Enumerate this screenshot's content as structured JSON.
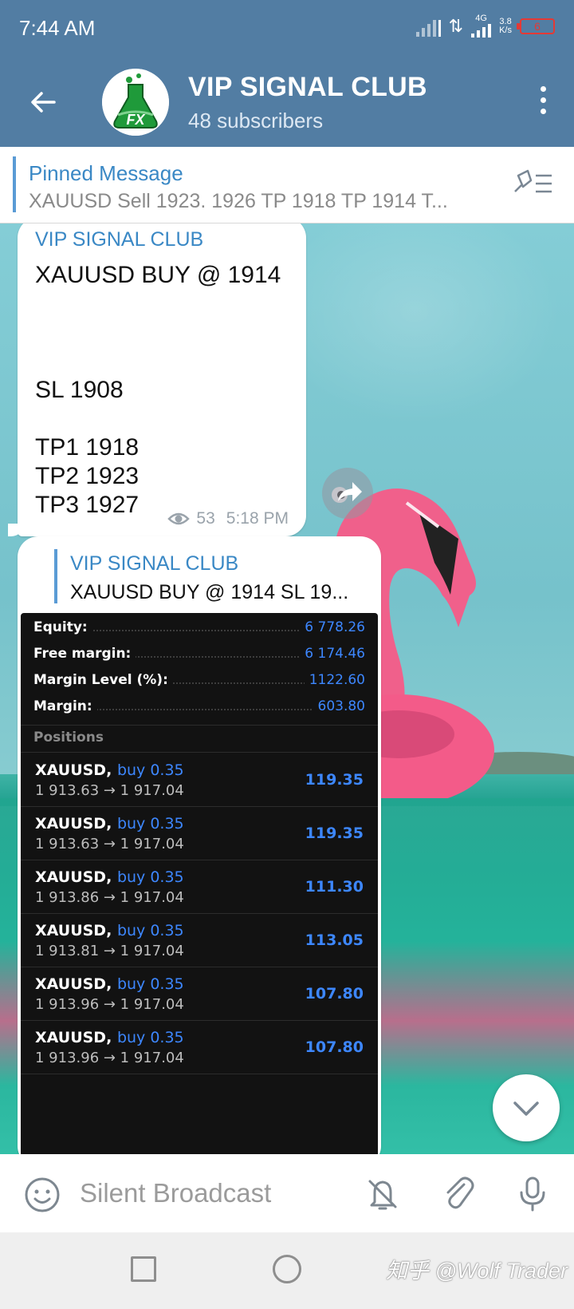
{
  "status_bar": {
    "time": "7:44 AM",
    "network_type": "4G",
    "speed_value": "3.8",
    "speed_unit": "K/s",
    "battery": "6",
    "battery_color": "#e53935"
  },
  "header": {
    "title": "VIP SIGNAL CLUB",
    "subtitle": "48 subscribers",
    "avatar_text": "FX",
    "color": "#527da3"
  },
  "pinned": {
    "label": "Pinned Message",
    "text": "XAUUSD Sell 1923.  1926 TP 1918 TP 1914 T..."
  },
  "messages": [
    {
      "sender": "VIP SIGNAL CLUB",
      "lines": [
        "XAUUSD BUY @ 1914",
        "SL 1908",
        "TP1 1918",
        "TP2 1923",
        "TP3 1927"
      ],
      "views": "53",
      "time": "5:18 PM"
    },
    {
      "sender": "VIP SIGNAL CLUB",
      "reply_text": "XAUUSD BUY @ 1914    SL 19...",
      "account": [
        {
          "label": "Equity:",
          "value": "6 778.26"
        },
        {
          "label": "Free margin:",
          "value": "6 174.46"
        },
        {
          "label": "Margin Level (%):",
          "value": "1122.60"
        },
        {
          "label": "Margin:",
          "value": "603.80"
        }
      ],
      "positions_header": "Positions",
      "positions": [
        {
          "symbol": "XAUUSD,",
          "side": "buy 0.35",
          "prices": "1 913.63 → 1 917.04",
          "profit": "119.35"
        },
        {
          "symbol": "XAUUSD,",
          "side": "buy 0.35",
          "prices": "1 913.63 → 1 917.04",
          "profit": "119.35"
        },
        {
          "symbol": "XAUUSD,",
          "side": "buy 0.35",
          "prices": "1 913.86 → 1 917.04",
          "profit": "111.30"
        },
        {
          "symbol": "XAUUSD,",
          "side": "buy 0.35",
          "prices": "1 913.81 → 1 917.04",
          "profit": "113.05"
        },
        {
          "symbol": "XAUUSD,",
          "side": "buy 0.35",
          "prices": "1 913.96 → 1 917.04",
          "profit": "107.80"
        },
        {
          "symbol": "XAUUSD,",
          "side": "buy 0.35",
          "prices": "1 913.96 → 1 917.04",
          "profit": "107.80"
        }
      ]
    }
  ],
  "composer": {
    "placeholder": "Silent Broadcast"
  },
  "icons": {
    "back": "arrow-left-icon",
    "menu": "more-vertical-icon",
    "pin": "pin-list-icon",
    "views": "eye-icon",
    "share": "share-icon",
    "scroll": "chevron-down-icon",
    "emoji": "smiley-icon",
    "mute": "bell-off-icon",
    "attach": "paperclip-icon",
    "mic": "microphone-icon"
  },
  "watermark": "知乎 @Wolf Trader"
}
